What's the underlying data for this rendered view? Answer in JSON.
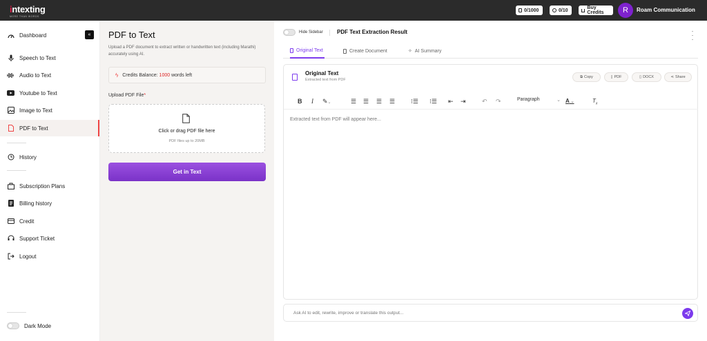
{
  "app": {
    "logo_main": "intexting",
    "logo_sub": "MORE THAN WORDS"
  },
  "topbar": {
    "words_counter": "0/1000",
    "time_counter": "0/10",
    "buy_credits": "Buy Credits",
    "avatar_initial": "R",
    "user_name": "Roam Communication"
  },
  "sidebar": {
    "items": [
      {
        "label": "Dashboard",
        "icon": "dashboard-icon"
      },
      {
        "label": "Speech to Text",
        "icon": "microphone-icon"
      },
      {
        "label": "Audio to Text",
        "icon": "audio-wave-icon"
      },
      {
        "label": "Youtube to Text",
        "icon": "youtube-icon"
      },
      {
        "label": "Image to Text",
        "icon": "image-icon"
      },
      {
        "label": "PDF to Text",
        "icon": "pdf-icon"
      },
      {
        "label": "History",
        "icon": "history-icon"
      },
      {
        "label": "Subscription Plans",
        "icon": "subscription-icon"
      },
      {
        "label": "Billing history",
        "icon": "billing-icon"
      },
      {
        "label": "Credit",
        "icon": "credit-icon"
      },
      {
        "label": "Support Ticket",
        "icon": "support-icon"
      },
      {
        "label": "Logout",
        "icon": "logout-icon"
      }
    ],
    "active_item": "PDF to Text",
    "dark_mode_label": "Dark Mode"
  },
  "upload_panel": {
    "title": "PDF to Text",
    "description": "Upload a PDF document to extract written or handwritten text (including Marathi) accurately using AI.",
    "credits_label": "Credits Balance:",
    "credits_value": "1000",
    "credits_suffix": "words left",
    "upload_label": "Upload PDF File",
    "required_mark": "*",
    "dropzone_text": "Click or drag PDF file here",
    "dropzone_hint": "PDF files up to 20MB",
    "submit_label": "Get in Text"
  },
  "result_panel": {
    "hide_sidebar_label": "Hide Sidebar",
    "title": "PDF Text Extraction Result",
    "tabs": [
      {
        "label": "Original Text",
        "icon": "document-icon"
      },
      {
        "label": "Create Document",
        "icon": "file-icon"
      },
      {
        "label": "AI Summary",
        "icon": "sparkle-icon"
      }
    ],
    "active_tab": "Original Text",
    "editor_title": "Original Text",
    "editor_subtitle": "Extracted text from PDF",
    "actions": {
      "copy": "Copy",
      "pdf": "PDF",
      "docx": "DOCX",
      "share": "Share"
    },
    "paragraph_style": "Paragraph",
    "placeholder": "Extracted text from PDF will appear here...",
    "chat_placeholder": "Ask AI to edit, rewrite, improve or translate this output..."
  },
  "colors": {
    "accent": "#7c3aed",
    "brand_red": "#e11d48",
    "topbar": "#2b2b2b"
  }
}
